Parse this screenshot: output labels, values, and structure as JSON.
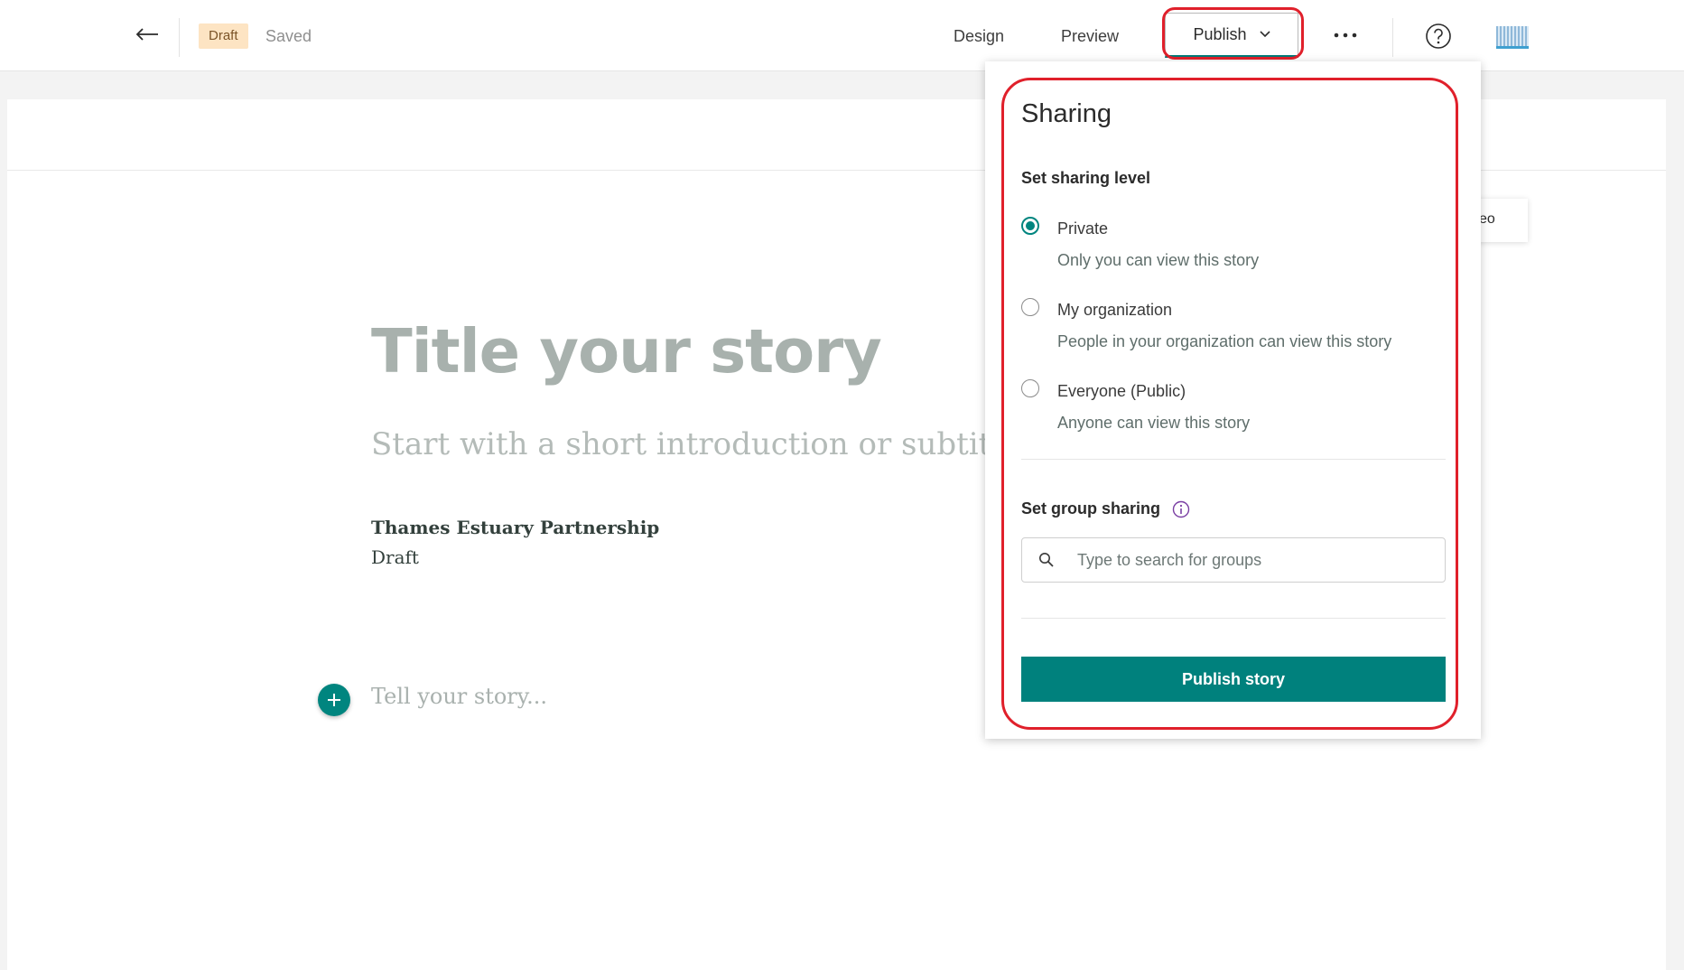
{
  "topbar": {
    "back_icon": "back-arrow-icon",
    "draft_badge": "Draft",
    "saved_status": "Saved",
    "nav_design": "Design",
    "nav_preview": "Preview",
    "publish_label": "Publish",
    "more_icon": "more-horizontal-icon",
    "help_icon": "help-icon",
    "avatar_icon": "account-avatar"
  },
  "story": {
    "title_placeholder": "Title your story",
    "subtitle_placeholder": "Start with a short introduction or subtitle",
    "author": "Thames Estuary Partnership",
    "status": "Draft",
    "body_placeholder": "Tell your story...",
    "side_tab_fragment": "eo"
  },
  "sharing": {
    "title": "Sharing",
    "level_heading": "Set sharing level",
    "options": [
      {
        "label": "Private",
        "description": "Only you can view this story",
        "selected": true
      },
      {
        "label": "My organization",
        "description": "People in your organization can view this story",
        "selected": false
      },
      {
        "label": "Everyone (Public)",
        "description": "Anyone can view this story",
        "selected": false
      }
    ],
    "group_heading": "Set group sharing",
    "group_search_placeholder": "Type to search for groups",
    "publish_button": "Publish story"
  },
  "colors": {
    "accent": "#00857f",
    "annotation": "#e0202b",
    "draft_badge_bg": "#fde4c3"
  }
}
